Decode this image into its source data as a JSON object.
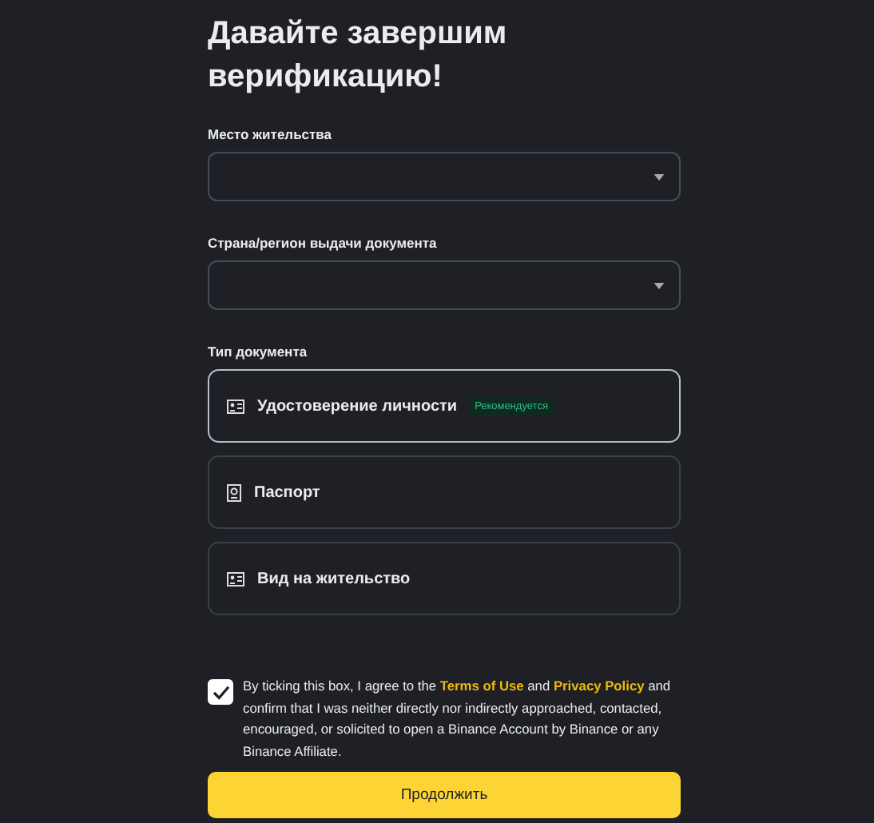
{
  "title": "Давайте завершим верификацию!",
  "residence": {
    "label": "Место жительства"
  },
  "issuing_country": {
    "label": "Страна/регион выдачи документа"
  },
  "document_type": {
    "label": "Тип документа",
    "options": [
      {
        "kind": "id-card",
        "label": "Удостоверение личности",
        "badge": "Рекомендуется",
        "selected": true
      },
      {
        "kind": "passport",
        "label": "Паспорт",
        "selected": false
      },
      {
        "kind": "id-card",
        "label": "Вид на жительство",
        "selected": false
      }
    ]
  },
  "consent": {
    "checked": true,
    "text_before": "By ticking this box, I agree to the ",
    "terms_link": "Terms of Use",
    "text_middle": " and ",
    "privacy_link": "Privacy Policy",
    "text_after": " and confirm that I was neither directly nor indirectly approached, contacted, encouraged, or solicited to open a Binance Account by Binance or any Binance Affiliate."
  },
  "continue_button": "Продолжить"
}
